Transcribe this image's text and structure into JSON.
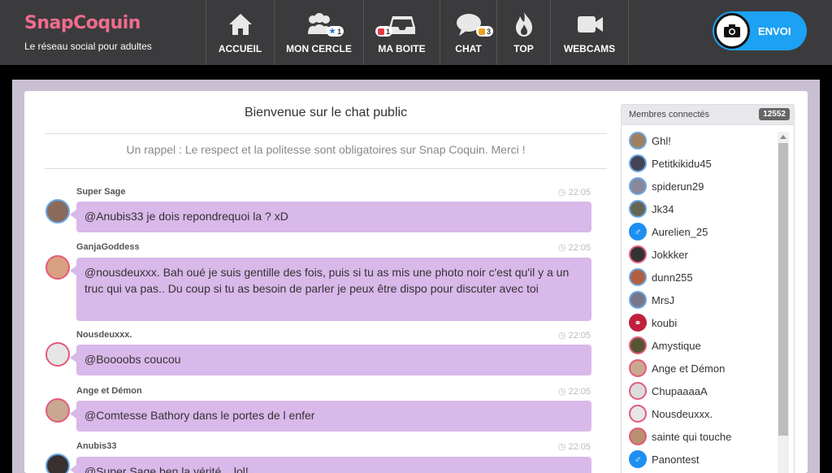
{
  "brand": {
    "logo": "SnapCoquin",
    "tagline": "Le réseau social pour adultes"
  },
  "nav": [
    {
      "label": "ACCUEIL",
      "icon": "home-icon"
    },
    {
      "label": "MON CERCLE",
      "icon": "group-icon",
      "badge": "1"
    },
    {
      "label": "MA BOITE",
      "icon": "inbox-icon",
      "badge": "1"
    },
    {
      "label": "CHAT",
      "icon": "chat-icon",
      "badge": "3"
    },
    {
      "label": "TOP",
      "icon": "flame-icon"
    },
    {
      "label": "WEBCAMS",
      "icon": "video-camera-icon"
    }
  ],
  "envoi": {
    "label": "ENVOI",
    "icon": "camera-icon"
  },
  "chat": {
    "title": "Bienvenue sur le chat public",
    "reminder": "Un rappel : Le respect et la politesse sont obligatoires sur Snap Coquin. Merci !",
    "messages": [
      {
        "author": "Super Sage",
        "time": "22:05",
        "text": "@Anubis33 je dois repondrequoi la ? xD"
      },
      {
        "author": "GanjaGoddess",
        "time": "22:05",
        "text": "@nousdeuxxx. Bah oué je suis gentille des fois, puis si tu as mis une photo noir c'est qu'il y a un truc qui va pas.. Du coup si tu as besoin de parler je peux être dispo pour discuter avec toi"
      },
      {
        "author": "Nousdeuxxx.",
        "time": "22:05",
        "text": "@Boooobs coucou"
      },
      {
        "author": "Ange et Démon",
        "time": "22:05",
        "text": "@Comtesse Bathory dans le portes de l enfer"
      },
      {
        "author": "Anubis33",
        "time": "22:05",
        "text": "@Super Sage ben la vérité... lol!"
      }
    ]
  },
  "members": {
    "title": "Membres connectés",
    "count": "12552",
    "list": [
      "Ghl!",
      "Petitkikidu45",
      "spiderun29",
      "Jk34",
      "Aurelien_25",
      "Jokkker",
      "dunn255",
      "MrsJ",
      "koubi",
      "Amystique",
      "Ange et Démon",
      "ChupaaaaA",
      "Nousdeuxxx.",
      "sainte qui touche",
      "Panontest"
    ]
  },
  "colors": {
    "accent": "#1da1f2",
    "bubble": "#d9b8ea",
    "brand": "#f06c8e",
    "header": "#3b3b3d"
  }
}
